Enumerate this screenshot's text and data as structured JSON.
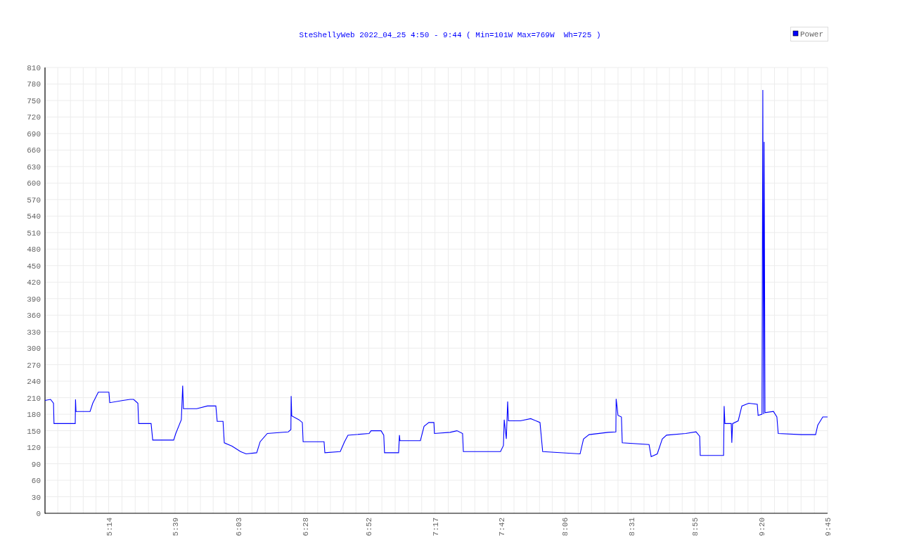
{
  "chart": {
    "chart_data": {
      "type": "line",
      "title": "SteShellyWeb 2022_04_25 4:50 - 9:44 ( Min=101W Max=769W  Wh=725 )",
      "x": [
        290,
        292.1,
        293.2,
        293.4,
        301.4,
        301.5,
        301.7,
        307,
        308,
        310.1,
        314.1,
        314.4,
        319.4,
        322.1,
        323.4,
        325,
        325.3,
        330,
        330.6,
        338.5,
        339.3,
        341.4,
        341.9,
        342.2,
        347.2,
        351.2,
        354.4,
        354.9,
        357.1,
        357.6,
        360.5,
        363.7,
        365.8,
        369.8,
        371.1,
        373.8,
        381.7,
        382.7,
        382.8,
        383,
        385.7,
        387,
        387.3,
        395.2,
        395.5,
        401.3,
        402.9,
        404.2,
        412.2,
        412.9,
        416.7,
        417.7,
        418,
        423.3,
        423.6,
        423.8,
        431.5,
        432.9,
        434.7,
        436.6,
        436.8,
        442.7,
        445.3,
        447.4,
        447.7,
        461.7,
        462.8,
        463.1,
        463.9,
        464.4,
        464.7,
        469.2,
        473.1,
        476.6,
        477.6,
        491.7,
        493,
        495.1,
        502.3,
        505.2,
        505.3,
        506,
        507.3,
        507.6,
        517.7,
        518.5,
        520.8,
        522.7,
        524.3,
        531.5,
        535.4,
        536.8,
        537,
        545.8,
        546,
        546.3,
        548.7,
        548.9,
        549.2,
        551.3,
        552.7,
        555.3,
        558.5,
        558.8,
        560.3,
        560.6,
        560.9,
        561.1,
        561.4,
        564.6,
        565.9,
        566.4,
        575.2,
        580.5,
        581.3,
        583.2,
        585
      ],
      "series": [
        {
          "name": "Power",
          "color": "#0000ff",
          "values": [
            205,
            207,
            200,
            163,
            163,
            207,
            185,
            185,
            200,
            220,
            220,
            201,
            205,
            207,
            207,
            200,
            163,
            163,
            133,
            133,
            145,
            170,
            232,
            190,
            190,
            195,
            195,
            167,
            167,
            128,
            122,
            112,
            108,
            110,
            130,
            145,
            148,
            152,
            213,
            177,
            170,
            165,
            130,
            130,
            110,
            112,
            130,
            142,
            145,
            150,
            150,
            142,
            110,
            110,
            142,
            132,
            132,
            158,
            165,
            165,
            145,
            147,
            150,
            145,
            112,
            112,
            123,
            170,
            135,
            203,
            168,
            168,
            172,
            165,
            112,
            108,
            135,
            143,
            147,
            148,
            208,
            178,
            175,
            128,
            125,
            103,
            108,
            135,
            142,
            145,
            148,
            140,
            105,
            105,
            195,
            163,
            163,
            128,
            163,
            168,
            195,
            200,
            198,
            178,
            180,
            769,
            180,
            675,
            183,
            185,
            175,
            145,
            143,
            143,
            160,
            175,
            175
          ]
        }
      ],
      "xlim": [
        290,
        585
      ],
      "ylim": [
        0,
        810
      ],
      "grid": true,
      "xticks": [
        {
          "value": 314,
          "label": "5:14"
        },
        {
          "value": 339,
          "label": "5:39"
        },
        {
          "value": 363,
          "label": "6:03"
        },
        {
          "value": 388,
          "label": "6:28"
        },
        {
          "value": 412,
          "label": "6:52"
        },
        {
          "value": 437,
          "label": "7:17"
        },
        {
          "value": 462,
          "label": "7:42"
        },
        {
          "value": 486,
          "label": "8:06"
        },
        {
          "value": 511,
          "label": "8:31"
        },
        {
          "value": 535,
          "label": "8:55"
        },
        {
          "value": 560,
          "label": "9:20"
        },
        {
          "value": 585,
          "label": "9:45"
        }
      ],
      "yticks": [
        0,
        30,
        60,
        90,
        120,
        150,
        180,
        210,
        240,
        270,
        300,
        330,
        360,
        390,
        420,
        450,
        480,
        510,
        540,
        570,
        600,
        630,
        660,
        690,
        720,
        750,
        780,
        810
      ]
    }
  }
}
